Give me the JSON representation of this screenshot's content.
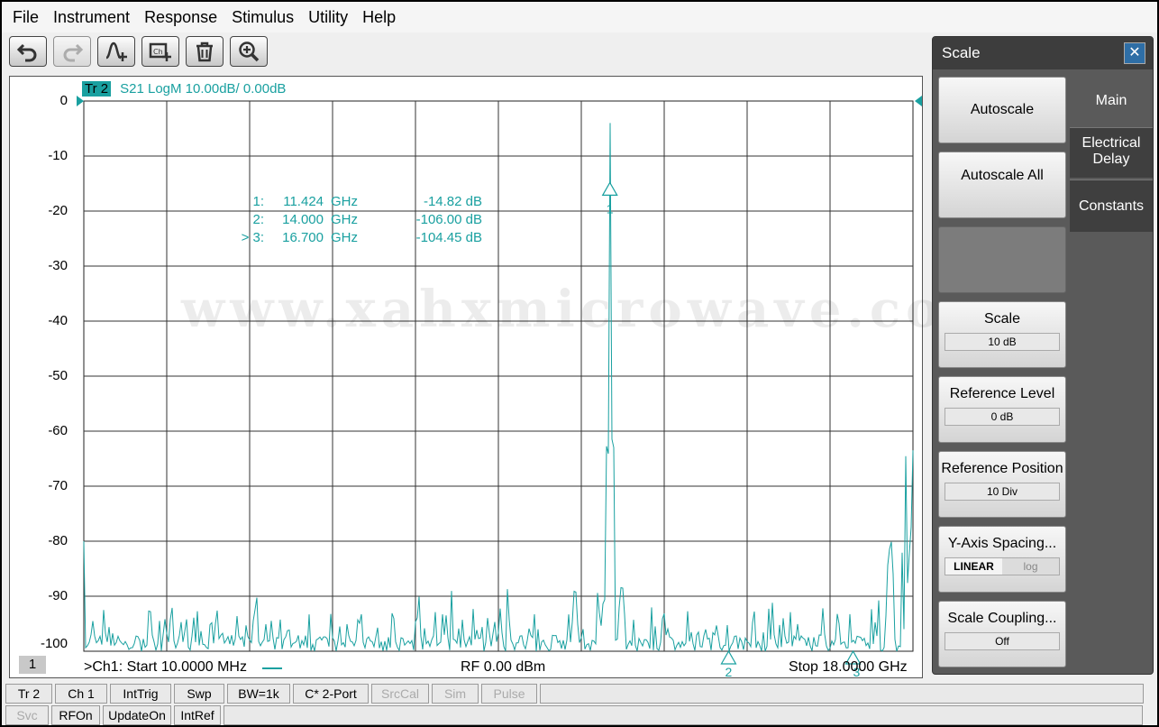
{
  "menu": [
    "File",
    "Instrument",
    "Response",
    "Stimulus",
    "Utility",
    "Help"
  ],
  "toolbar": [
    {
      "name": "undo-button",
      "icon": "undo-icon",
      "enabled": true
    },
    {
      "name": "redo-button",
      "icon": "redo-icon",
      "enabled": false
    },
    {
      "name": "add-marker-button",
      "icon": "marker-add-icon",
      "enabled": true
    },
    {
      "name": "add-channel-button",
      "icon": "channel-add-icon",
      "enabled": true
    },
    {
      "name": "delete-button",
      "icon": "trash-icon",
      "enabled": true
    },
    {
      "name": "zoom-button",
      "icon": "zoom-in-icon",
      "enabled": true
    }
  ],
  "trace": {
    "chip": "Tr 2",
    "desc": "S21 LogM 10.00dB/  0.00dB",
    "color": "#19a0a0"
  },
  "y_ticks": [
    "0",
    "-10",
    "-20",
    "-30",
    "-40",
    "-50",
    "-60",
    "-70",
    "-80",
    "-90",
    "-100"
  ],
  "markers": [
    {
      "id": "1:",
      "freq": "11.424",
      "unit": "GHz",
      "value": "-14.82 dB"
    },
    {
      "id": "2:",
      "freq": "14.000",
      "unit": "GHz",
      "value": "-106.00 dB"
    },
    {
      "id": "> 3:",
      "freq": "16.700",
      "unit": "GHz",
      "value": "-104.45 dB"
    }
  ],
  "marker_flags": [
    "1",
    "2",
    "3"
  ],
  "watermark": "www.xahxmicrowave.com",
  "footer": {
    "channel": "1",
    "start": ">Ch1:  Start  10.0000 MHz",
    "rf": "RF    0.00 dBm",
    "stop": "Stop  18.0000 GHz"
  },
  "chart_data": {
    "type": "line",
    "xlim_ghz": [
      0.01,
      18.0
    ],
    "ylim_db": [
      -100,
      0
    ],
    "y_scale_per_div": 10,
    "grid": true,
    "series": [
      {
        "name": "S21 LogM",
        "color": "#19a0a0"
      }
    ],
    "peak": {
      "x_ghz": 11.424,
      "y_db": -4
    },
    "marker_points": [
      {
        "label": "1",
        "x_ghz": 11.424,
        "y_db": -14.82
      },
      {
        "label": "2",
        "x_ghz": 14.0,
        "y_db": -106.0
      },
      {
        "label": "3",
        "x_ghz": 16.7,
        "y_db": -104.45
      }
    ]
  },
  "panel": {
    "title": "Scale",
    "close": "✕",
    "tabs": [
      "Main",
      "Electrical\nDelay",
      "Constants"
    ],
    "buttons": [
      {
        "label": "Autoscale"
      },
      {
        "label": "Autoscale All"
      },
      {
        "label": ""
      },
      {
        "label": "Scale",
        "value": "10 dB"
      },
      {
        "label": "Reference Level",
        "value": "0 dB"
      },
      {
        "label": "Reference Position",
        "value": "10 Div"
      },
      {
        "label": "Y-Axis Spacing...",
        "seg_on": "LINEAR",
        "seg_off": "log"
      },
      {
        "label": "Scale Coupling...",
        "value": "Off"
      }
    ]
  },
  "status_row1": [
    {
      "label": "Tr 2",
      "dim": false
    },
    {
      "label": "Ch 1",
      "dim": false
    },
    {
      "label": "IntTrig",
      "dim": false
    },
    {
      "label": "Swp",
      "dim": false
    },
    {
      "label": "BW=1k",
      "dim": false
    },
    {
      "label": "C* 2-Port",
      "dim": false
    },
    {
      "label": "SrcCal",
      "dim": true
    },
    {
      "label": "Sim",
      "dim": true
    },
    {
      "label": "Pulse",
      "dim": true
    }
  ],
  "status_row2": [
    {
      "label": "Svc",
      "dim": true
    },
    {
      "label": "RFOn",
      "dim": false
    },
    {
      "label": "UpdateOn",
      "dim": false
    },
    {
      "label": "IntRef",
      "dim": false
    }
  ]
}
